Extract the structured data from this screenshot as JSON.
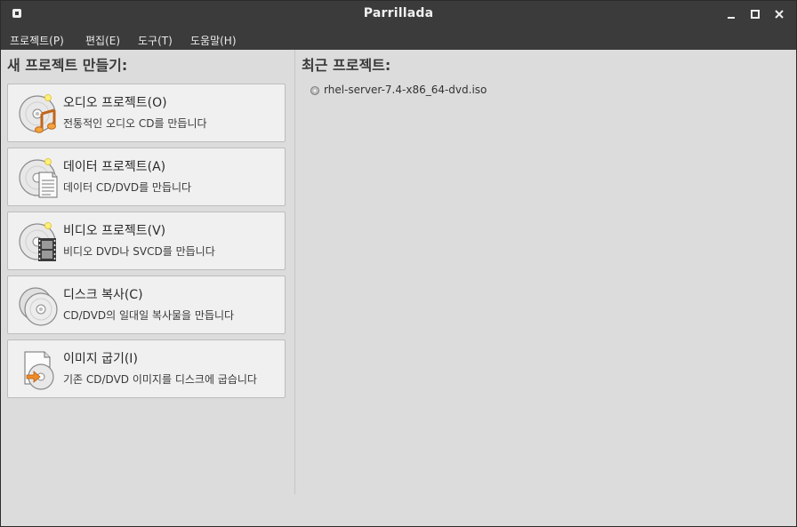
{
  "window": {
    "title": "Parrillada"
  },
  "menubar": {
    "items": [
      "프로젝트(P)",
      "편집(E)",
      "도구(T)",
      "도움말(H)"
    ]
  },
  "new_project": {
    "heading": "새 프로젝트 만들기:",
    "items": [
      {
        "label": "오디오 프로젝트(O)",
        "desc": "전통적인 오디오 CD를 만듭니다",
        "icon": "audio-disc-icon"
      },
      {
        "label": "데이터 프로젝트(A)",
        "desc": "데이터 CD/DVD를 만듭니다",
        "icon": "data-disc-icon"
      },
      {
        "label": "비디오 프로젝트(V)",
        "desc": "비디오 DVD나 SVCD를 만듭니다",
        "icon": "video-disc-icon"
      },
      {
        "label": "디스크 복사(C)",
        "desc": "CD/DVD의 일대일 복사물을 만듭니다",
        "icon": "disc-copy-icon"
      },
      {
        "label": "이미지 굽기(I)",
        "desc": "기존 CD/DVD 이미지를 디스크에 굽습니다",
        "icon": "burn-image-icon"
      }
    ]
  },
  "recent": {
    "heading": "최근 프로젝트:",
    "items": [
      {
        "label": "rhel-server-7.4-x86_64-dvd.iso"
      }
    ]
  }
}
